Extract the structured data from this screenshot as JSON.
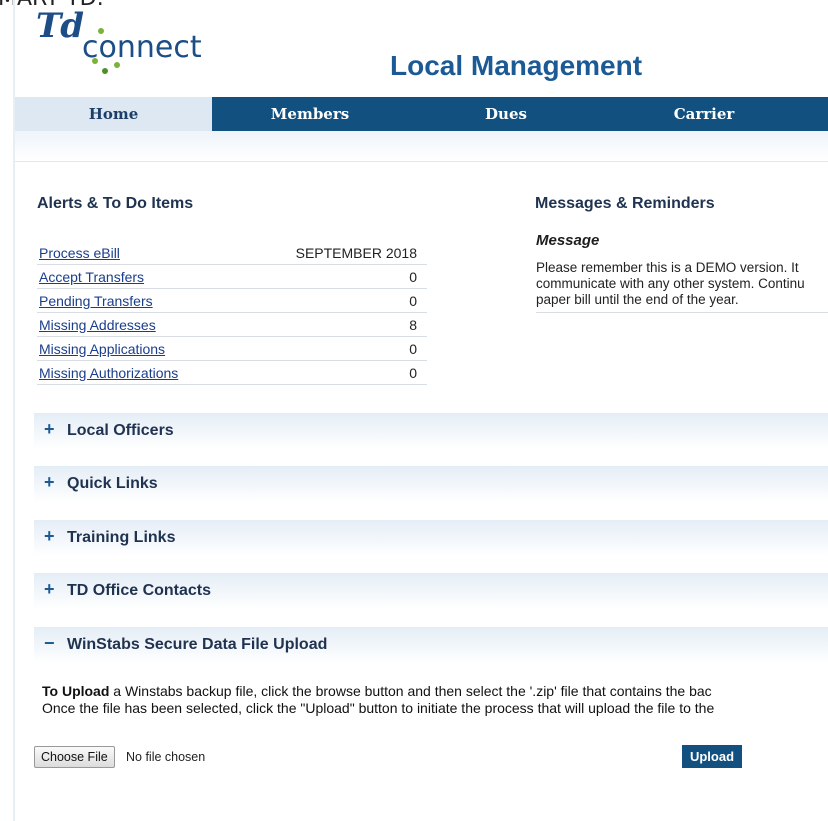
{
  "clipped_top_text": "MART TD:",
  "logo": {
    "td": "Td",
    "connect": "connect"
  },
  "page_title": "Local Management",
  "nav": {
    "tabs": [
      "Home",
      "Members",
      "Dues",
      "Carrier"
    ],
    "active": "Home"
  },
  "alerts": {
    "title": "Alerts & To Do Items",
    "rows": [
      {
        "label": "Process eBill",
        "value": "SEPTEMBER 2018"
      },
      {
        "label": "Accept Transfers",
        "value": "0"
      },
      {
        "label": "Pending Transfers",
        "value": "0"
      },
      {
        "label": "Missing Addresses",
        "value": "8"
      },
      {
        "label": "Missing Applications",
        "value": "0"
      },
      {
        "label": "Missing Authorizations",
        "value": "0"
      }
    ]
  },
  "messages": {
    "title": "Messages & Reminders",
    "message_heading": "Message",
    "lines": [
      "Please remember this is a DEMO version. It",
      "communicate with any other system. Continu",
      "paper bill until the end of the year."
    ]
  },
  "sections": [
    {
      "sign": "+",
      "label": "Local Officers"
    },
    {
      "sign": "+",
      "label": "Quick Links"
    },
    {
      "sign": "+",
      "label": "Training Links"
    },
    {
      "sign": "+",
      "label": "TD Office Contacts"
    },
    {
      "sign": "−",
      "label": "WinStabs Secure Data File Upload"
    }
  ],
  "upload": {
    "bold_lead": "To Upload",
    "line1_rest": " a Winstabs backup file, click the browse button and then select the '.zip' file that contains the bac",
    "line2": "Once the file has been selected, click the \"Upload\" button to initiate the process that will upload the file to the",
    "choose_label": "Choose File",
    "no_file_text": "No file chosen",
    "upload_label": "Upload"
  },
  "colors": {
    "navbar": "#12507f",
    "title": "#1c5a96",
    "link": "#1a3e8c"
  }
}
